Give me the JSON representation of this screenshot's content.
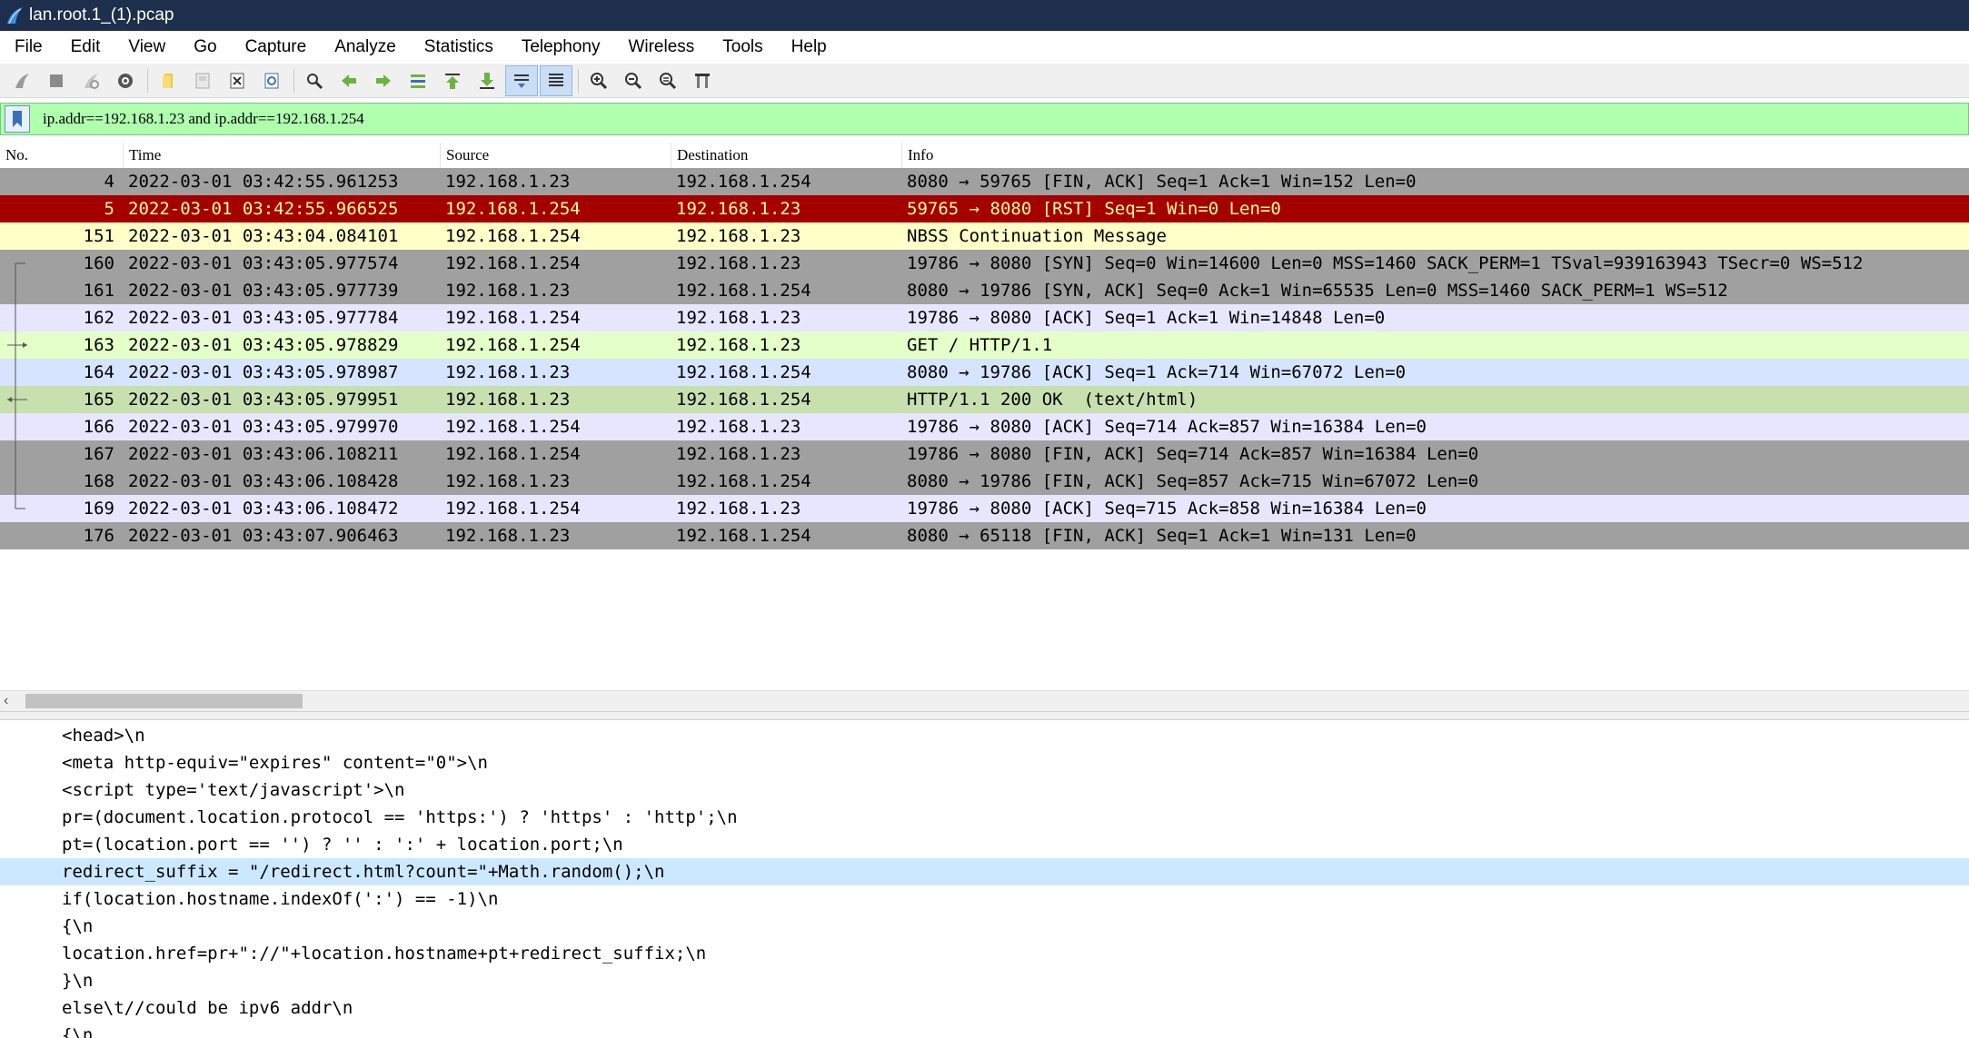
{
  "window": {
    "title": "lan.root.1_(1).pcap"
  },
  "menu": [
    "File",
    "Edit",
    "View",
    "Go",
    "Capture",
    "Analyze",
    "Statistics",
    "Telephony",
    "Wireless",
    "Tools",
    "Help"
  ],
  "toolbar": {
    "buttons": [
      "start-capture-icon",
      "stop-capture-icon",
      "restart-capture-icon",
      "capture-options-icon",
      "open-file-icon",
      "save-file-icon",
      "close-file-icon",
      "reload-file-icon",
      "find-packet-icon",
      "go-back-icon",
      "go-forward-icon",
      "go-to-packet-icon",
      "go-first-packet-icon",
      "go-last-packet-icon",
      "autoscroll-icon",
      "colorize-icon",
      "zoom-in-icon",
      "zoom-out-icon",
      "normal-size-icon",
      "resize-columns-icon"
    ]
  },
  "filter": {
    "value": "ip.addr==192.168.1.23 and ip.addr==192.168.1.254",
    "bg_color": "#afffaf"
  },
  "packet_list": {
    "columns": [
      "No.",
      "Time",
      "Source",
      "Destination",
      "Info"
    ],
    "rows": [
      {
        "no": "4",
        "time": "2022-03-01 03:42:55.961253",
        "src": "192.168.1.23",
        "dst": "192.168.1.254",
        "info": "8080 → 59765 [FIN, ACK] Seq=1 Ack=1 Win=152 Len=0",
        "color": "gray"
      },
      {
        "no": "5",
        "time": "2022-03-01 03:42:55.966525",
        "src": "192.168.1.254",
        "dst": "192.168.1.23",
        "info": "59765 → 8080 [RST] Seq=1 Win=0 Len=0",
        "color": "red"
      },
      {
        "no": "151",
        "time": "2022-03-01 03:43:04.084101",
        "src": "192.168.1.254",
        "dst": "192.168.1.23",
        "info": "NBSS Continuation Message",
        "color": "yellow"
      },
      {
        "no": "160",
        "time": "2022-03-01 03:43:05.977574",
        "src": "192.168.1.254",
        "dst": "192.168.1.23",
        "info": "19786 → 8080 [SYN] Seq=0 Win=14600 Len=0 MSS=1460 SACK_PERM=1 TSval=939163943 TSecr=0 WS=512",
        "color": "gray",
        "rel": "first"
      },
      {
        "no": "161",
        "time": "2022-03-01 03:43:05.977739",
        "src": "192.168.1.23",
        "dst": "192.168.1.254",
        "info": "8080 → 19786 [SYN, ACK] Seq=0 Ack=1 Win=65535 Len=0 MSS=1460 SACK_PERM=1 WS=512",
        "color": "gray",
        "rel": "line"
      },
      {
        "no": "162",
        "time": "2022-03-01 03:43:05.977784",
        "src": "192.168.1.254",
        "dst": "192.168.1.23",
        "info": "19786 → 8080 [ACK] Seq=1 Ack=1 Win=14848 Len=0",
        "color": "lav",
        "rel": "line"
      },
      {
        "no": "163",
        "time": "2022-03-01 03:43:05.978829",
        "src": "192.168.1.254",
        "dst": "192.168.1.23",
        "info": "GET / HTTP/1.1",
        "color": "green",
        "rel": "request"
      },
      {
        "no": "164",
        "time": "2022-03-01 03:43:05.978987",
        "src": "192.168.1.23",
        "dst": "192.168.1.254",
        "info": "8080 → 19786 [ACK] Seq=1 Ack=714 Win=67072 Len=0",
        "color": "blue",
        "rel": "line"
      },
      {
        "no": "165",
        "time": "2022-03-01 03:43:05.979951",
        "src": "192.168.1.23",
        "dst": "192.168.1.254",
        "info": "HTTP/1.1 200 OK  (text/html)",
        "color": "olive",
        "rel": "response"
      },
      {
        "no": "166",
        "time": "2022-03-01 03:43:05.979970",
        "src": "192.168.1.254",
        "dst": "192.168.1.23",
        "info": "19786 → 8080 [ACK] Seq=714 Ack=857 Win=16384 Len=0",
        "color": "lav",
        "rel": "line"
      },
      {
        "no": "167",
        "time": "2022-03-01 03:43:06.108211",
        "src": "192.168.1.254",
        "dst": "192.168.1.23",
        "info": "19786 → 8080 [FIN, ACK] Seq=714 Ack=857 Win=16384 Len=0",
        "color": "gray",
        "rel": "line"
      },
      {
        "no": "168",
        "time": "2022-03-01 03:43:06.108428",
        "src": "192.168.1.23",
        "dst": "192.168.1.254",
        "info": "8080 → 19786 [FIN, ACK] Seq=857 Ack=715 Win=67072 Len=0",
        "color": "gray",
        "rel": "line"
      },
      {
        "no": "169",
        "time": "2022-03-01 03:43:06.108472",
        "src": "192.168.1.254",
        "dst": "192.168.1.23",
        "info": "19786 → 8080 [ACK] Seq=715 Ack=858 Win=16384 Len=0",
        "color": "lav",
        "rel": "last"
      },
      {
        "no": "176",
        "time": "2022-03-01 03:43:07.906463",
        "src": "192.168.1.23",
        "dst": "192.168.1.254",
        "info": "8080 → 65118 [FIN, ACK] Seq=1 Ack=1 Win=131 Len=0",
        "color": "gray"
      }
    ]
  },
  "details": {
    "lines": [
      "<head>\\n",
      "<meta http-equiv=\"expires\" content=\"0\">\\n",
      "<script type='text/javascript'>\\n",
      "pr=(document.location.protocol == 'https:') ? 'https' : 'http';\\n",
      "pt=(location.port == '') ? '' : ':' + location.port;\\n",
      "redirect_suffix = \"/redirect.html?count=\"+Math.random();\\n",
      "if(location.hostname.indexOf(':') == -1)\\n",
      "{\\n",
      "location.href=pr+\"://\"+location.hostname+pt+redirect_suffix;\\n",
      "}\\n",
      "else\\t//could be ipv6 addr\\n",
      "{\\n"
    ],
    "selected_index": 5
  }
}
